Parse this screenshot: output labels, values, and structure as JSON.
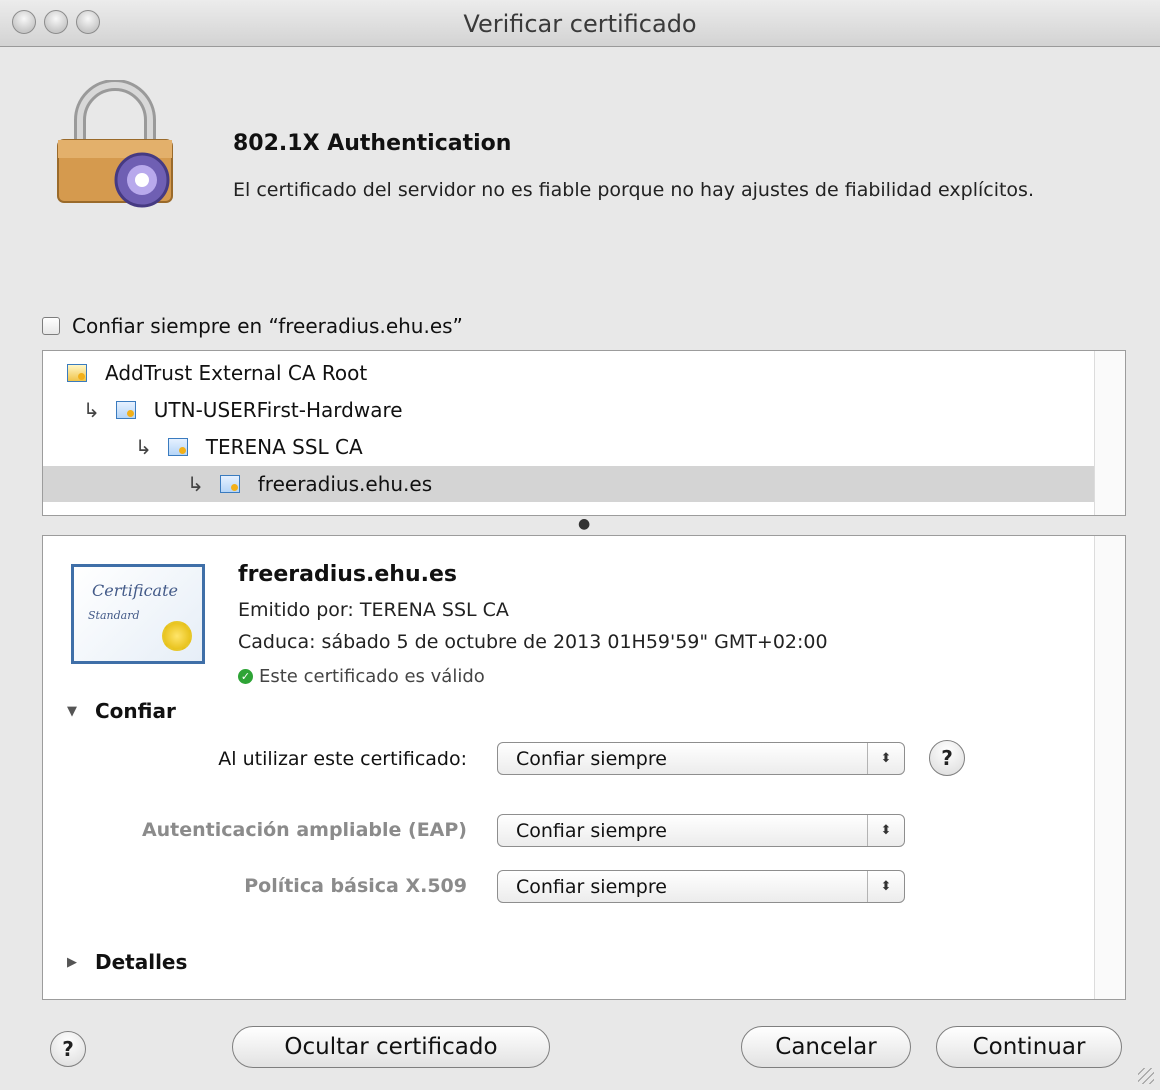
{
  "window": {
    "title": "Verificar certificado"
  },
  "header": {
    "title": "802.1X Authentication",
    "message": "El certificado del servidor no es fiable porque no hay ajustes de fiabilidad explícitos."
  },
  "trust_always": {
    "label": "Confiar siempre en “freeradius.ehu.es”",
    "checked": false
  },
  "chain": [
    {
      "label": "AddTrust External CA Root",
      "level": 0,
      "selected": false
    },
    {
      "label": "UTN-USERFirst-Hardware",
      "level": 1,
      "selected": false
    },
    {
      "label": "TERENA SSL CA",
      "level": 2,
      "selected": false
    },
    {
      "label": "freeradius.ehu.es",
      "level": 3,
      "selected": true
    }
  ],
  "cert": {
    "image_text_1": "Certificate",
    "image_text_2": "Standard",
    "name": "freeradius.ehu.es",
    "issued_by": "Emitido por: TERENA SSL CA",
    "expires": "Caduca: sábado 5 de octubre de 2013 01H59'59\" GMT+02:00",
    "status": "Este certificado es válido"
  },
  "trust_section": {
    "label": "Confiar",
    "expanded": true,
    "rows": [
      {
        "label": "Al utilizar este certificado:",
        "value": "Confiar siempre",
        "dimmed": false
      },
      {
        "label": "Autenticación ampliable (EAP)",
        "value": "Confiar siempre",
        "dimmed": true
      },
      {
        "label": "Política básica X.509",
        "value": "Confiar siempre",
        "dimmed": true
      }
    ]
  },
  "details_section": {
    "label": "Detalles",
    "expanded": false
  },
  "buttons": {
    "help": "?",
    "hide_cert": "Ocultar certificado",
    "cancel": "Cancelar",
    "continue": "Continuar"
  },
  "icons": {
    "tree_arrow": "↳",
    "expanded_triangle": "▼",
    "collapsed_triangle": "▶",
    "stepper": "⬍",
    "check": "✓"
  }
}
